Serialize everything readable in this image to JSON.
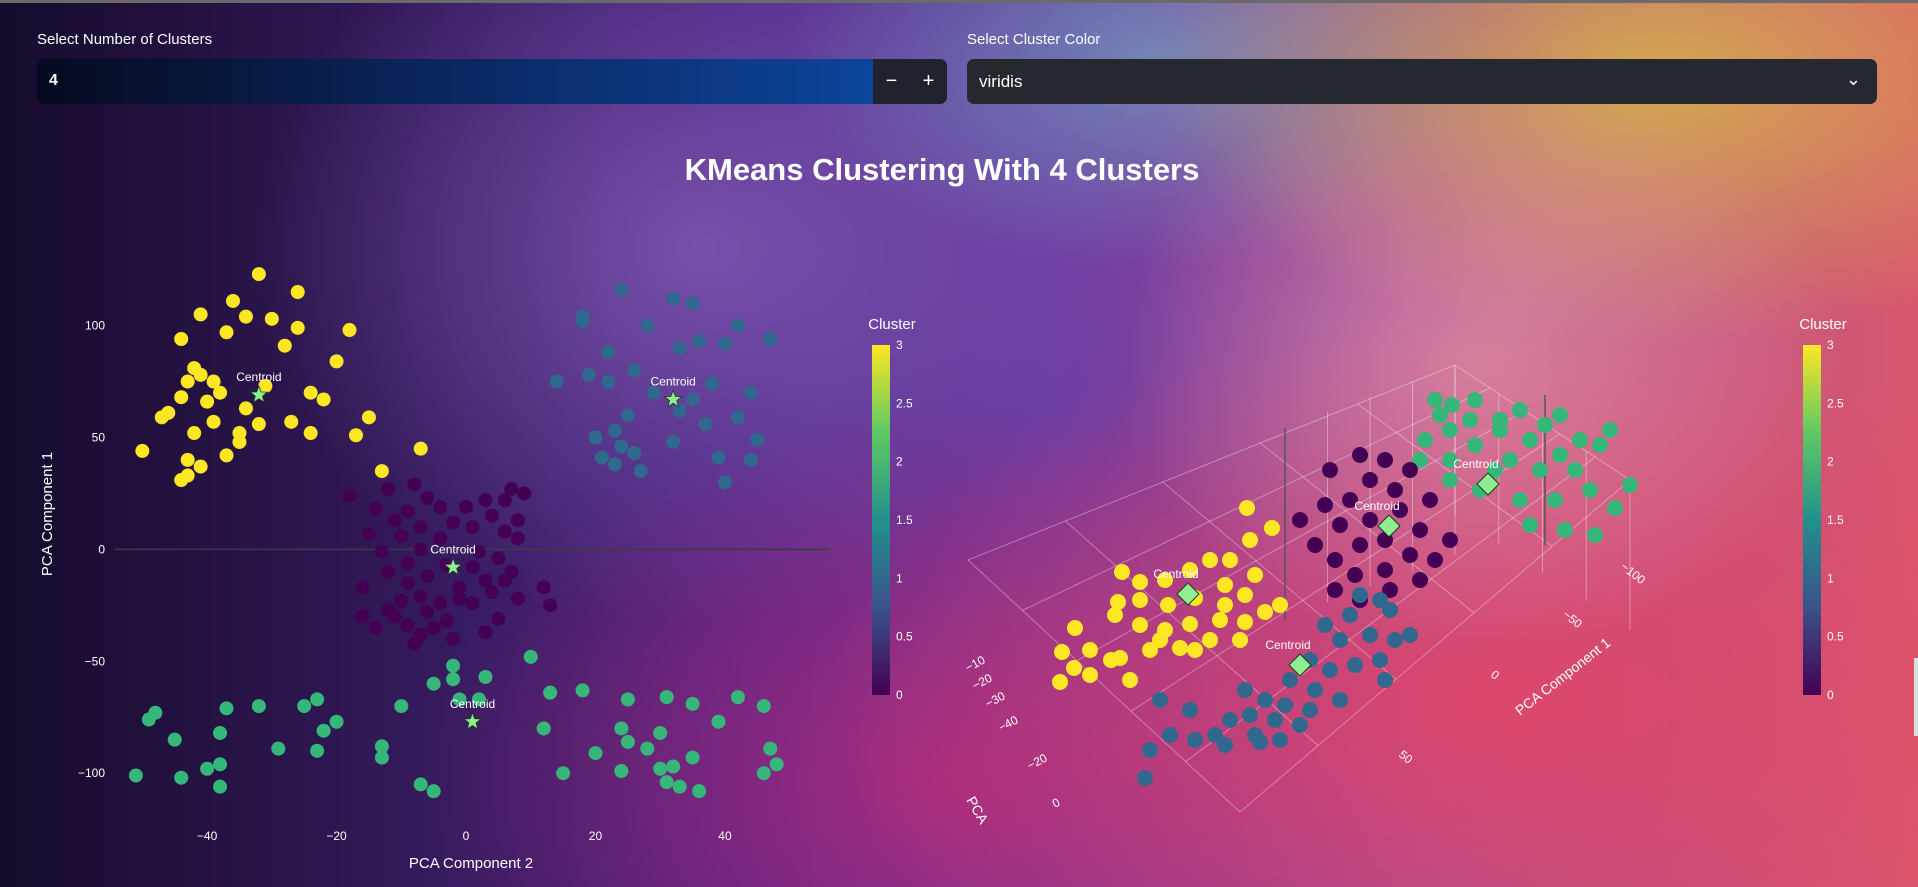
{
  "controls": {
    "clusters_label": "Select Number of Clusters",
    "clusters_value": "4",
    "decrement_label": "−",
    "increment_label": "+",
    "color_label": "Select Cluster Color",
    "color_value": "viridis"
  },
  "colors": {
    "cluster_0": "#440154",
    "cluster_1": "#31688e",
    "cluster_2": "#35b779",
    "cluster_3": "#fde725",
    "centroid": "#90ee90"
  },
  "chart_data": [
    {
      "type": "scatter",
      "title": "KMeans Clustering With 4 Clusters",
      "xlabel": "PCA Component 2",
      "ylabel": "PCA Component 1",
      "xlim": [
        -55,
        57
      ],
      "ylim": [
        -120,
        115
      ],
      "xticks": [
        -40,
        -20,
        0,
        20,
        40
      ],
      "yticks": [
        100,
        50,
        0,
        -50,
        -100
      ],
      "colorbar": {
        "title": "Cluster",
        "ticks": [
          "3",
          "2.5",
          "2",
          "1.5",
          "1",
          "0.5",
          "0"
        ],
        "colormap": "viridis"
      },
      "series": [
        {
          "cluster": 3,
          "points": [
            [
              -32,
              123
            ],
            [
              -26,
              115
            ],
            [
              -36,
              111
            ],
            [
              -41,
              105
            ],
            [
              -34,
              104
            ],
            [
              -30,
              103
            ],
            [
              -26,
              99
            ],
            [
              -37,
              97
            ],
            [
              -18,
              98
            ],
            [
              -44,
              94
            ],
            [
              -28,
              91
            ],
            [
              -20,
              84
            ],
            [
              -42,
              81
            ],
            [
              -41,
              78
            ],
            [
              -39,
              75
            ],
            [
              -43,
              75
            ],
            [
              -31,
              73
            ],
            [
              -24,
              70
            ],
            [
              -38,
              70
            ],
            [
              -44,
              68
            ],
            [
              -40,
              66
            ],
            [
              -22,
              67
            ],
            [
              -34,
              63
            ],
            [
              -15,
              59
            ],
            [
              -46,
              61
            ],
            [
              -47,
              59
            ],
            [
              -27,
              57
            ],
            [
              -39,
              57
            ],
            [
              -32,
              56
            ],
            [
              -35,
              52
            ],
            [
              -17,
              51
            ],
            [
              -35,
              48
            ],
            [
              -7,
              45
            ],
            [
              -50,
              44
            ],
            [
              -43,
              40
            ],
            [
              -41,
              37
            ],
            [
              -13,
              35
            ],
            [
              -44,
              31
            ],
            [
              -43,
              33
            ],
            [
              -24,
              52
            ],
            [
              -37,
              42
            ],
            [
              -42,
              52
            ]
          ]
        },
        {
          "cluster": 0,
          "points": [
            [
              -8,
              29
            ],
            [
              -12,
              27
            ],
            [
              -18,
              24
            ],
            [
              -6,
              23
            ],
            [
              -4,
              19
            ],
            [
              7,
              27
            ],
            [
              9,
              25
            ],
            [
              6,
              22
            ],
            [
              -14,
              18
            ],
            [
              0,
              19
            ],
            [
              3,
              22
            ],
            [
              -9,
              17
            ],
            [
              4,
              15
            ],
            [
              8,
              13
            ],
            [
              -11,
              13
            ],
            [
              -2,
              12
            ],
            [
              -7,
              10
            ],
            [
              1,
              10
            ],
            [
              6,
              8
            ],
            [
              -15,
              7
            ],
            [
              -10,
              6
            ],
            [
              -4,
              5
            ],
            [
              8,
              5
            ],
            [
              -7,
              0
            ],
            [
              2,
              -1
            ],
            [
              -13,
              -1
            ],
            [
              5,
              -4
            ],
            [
              -9,
              -6
            ],
            [
              -3,
              -7
            ],
            [
              -12,
              -10
            ],
            [
              1,
              -8
            ],
            [
              7,
              -10
            ],
            [
              -6,
              -12
            ],
            [
              -9,
              -15
            ],
            [
              -16,
              -17
            ],
            [
              3,
              -14
            ],
            [
              -1,
              -17
            ],
            [
              -7,
              -21
            ],
            [
              -10,
              -23
            ],
            [
              4,
              -19
            ],
            [
              8,
              -22
            ],
            [
              1,
              -24
            ],
            [
              -12,
              -27
            ],
            [
              -6,
              -28
            ],
            [
              -3,
              -32
            ],
            [
              -11,
              -30
            ],
            [
              -5,
              -35
            ],
            [
              -14,
              -35
            ],
            [
              12,
              -17
            ],
            [
              13,
              -25
            ],
            [
              -2,
              -40
            ],
            [
              -8,
              -42
            ],
            [
              5,
              -31
            ],
            [
              -4,
              -24
            ],
            [
              -1,
              -22
            ],
            [
              3,
              -37
            ],
            [
              -9,
              -34
            ],
            [
              -7,
              -38
            ],
            [
              -16,
              -30
            ],
            [
              6,
              -14
            ]
          ]
        },
        {
          "cluster": 1,
          "points": [
            [
              24,
              116
            ],
            [
              32,
              112
            ],
            [
              18,
              104
            ],
            [
              35,
              110
            ],
            [
              28,
              100
            ],
            [
              36,
              93
            ],
            [
              33,
              90
            ],
            [
              42,
              100
            ],
            [
              40,
              92
            ],
            [
              47,
              94
            ],
            [
              22,
              88
            ],
            [
              26,
              80
            ],
            [
              14,
              75
            ],
            [
              22,
              75
            ],
            [
              38,
              74
            ],
            [
              44,
              70
            ],
            [
              29,
              70
            ],
            [
              35,
              67
            ],
            [
              42,
              59
            ],
            [
              25,
              60
            ],
            [
              37,
              56
            ],
            [
              23,
              53
            ],
            [
              20,
              50
            ],
            [
              45,
              49
            ],
            [
              32,
              48
            ],
            [
              26,
              43
            ],
            [
              21,
              41
            ],
            [
              27,
              35
            ],
            [
              39,
              41
            ],
            [
              44,
              40
            ],
            [
              40,
              30
            ],
            [
              23,
              38
            ],
            [
              33,
              62
            ],
            [
              18,
              102
            ],
            [
              19,
              78
            ],
            [
              24,
              46
            ]
          ]
        },
        {
          "cluster": 2,
          "points": [
            [
              -2,
              -52
            ],
            [
              10,
              -48
            ],
            [
              3,
              -57
            ],
            [
              -5,
              -60
            ],
            [
              -1,
              -67
            ],
            [
              2,
              -67
            ],
            [
              13,
              -64
            ],
            [
              18,
              -63
            ],
            [
              -23,
              -67
            ],
            [
              -25,
              -70
            ],
            [
              -10,
              -70
            ],
            [
              -20,
              -77
            ],
            [
              -22,
              -81
            ],
            [
              -37,
              -71
            ],
            [
              -32,
              -70
            ],
            [
              -49,
              -76
            ],
            [
              -48,
              -73
            ],
            [
              -45,
              -85
            ],
            [
              -38,
              -82
            ],
            [
              -38,
              -96
            ],
            [
              -23,
              -90
            ],
            [
              -13,
              -88
            ],
            [
              -40,
              -98
            ],
            [
              -44,
              -102
            ],
            [
              -51,
              -101
            ],
            [
              -38,
              -106
            ],
            [
              -7,
              -105
            ],
            [
              -5,
              -108
            ],
            [
              25,
              -67
            ],
            [
              31,
              -66
            ],
            [
              35,
              -69
            ],
            [
              42,
              -66
            ],
            [
              46,
              -70
            ],
            [
              39,
              -77
            ],
            [
              24,
              -80
            ],
            [
              30,
              -82
            ],
            [
              25,
              -86
            ],
            [
              28,
              -89
            ],
            [
              32,
              -97
            ],
            [
              35,
              -93
            ],
            [
              20,
              -91
            ],
            [
              47,
              -89
            ],
            [
              48,
              -96
            ],
            [
              24,
              -99
            ],
            [
              30,
              -98
            ],
            [
              46,
              -100
            ],
            [
              31,
              -104
            ],
            [
              33,
              -106
            ],
            [
              36,
              -108
            ],
            [
              -13,
              -93
            ],
            [
              12,
              -80
            ],
            [
              -29,
              -89
            ],
            [
              15,
              -100
            ],
            [
              -2,
              -58
            ]
          ]
        },
        {
          "cluster": "centroid",
          "label": "Centroid",
          "points": [
            [
              -32,
              69
            ],
            [
              32,
              67
            ],
            [
              -2,
              -8
            ],
            [
              1,
              -77
            ]
          ]
        }
      ]
    },
    {
      "type": "scatter",
      "subtype": "3d",
      "x_axis_label": "PCA Component 1",
      "y_axis_label": "PCA",
      "x_ticks": [
        "-100",
        "-50",
        "0",
        "50"
      ],
      "y_ticks": [
        "-10",
        "-20",
        "-30",
        "-40",
        "-20",
        "0"
      ],
      "colorbar": {
        "title": "Cluster",
        "ticks": [
          "3",
          "2.5",
          "2",
          "1.5",
          "1",
          "0.5",
          "0"
        ],
        "colormap": "viridis"
      },
      "centroid_label": "Centroid"
    }
  ]
}
